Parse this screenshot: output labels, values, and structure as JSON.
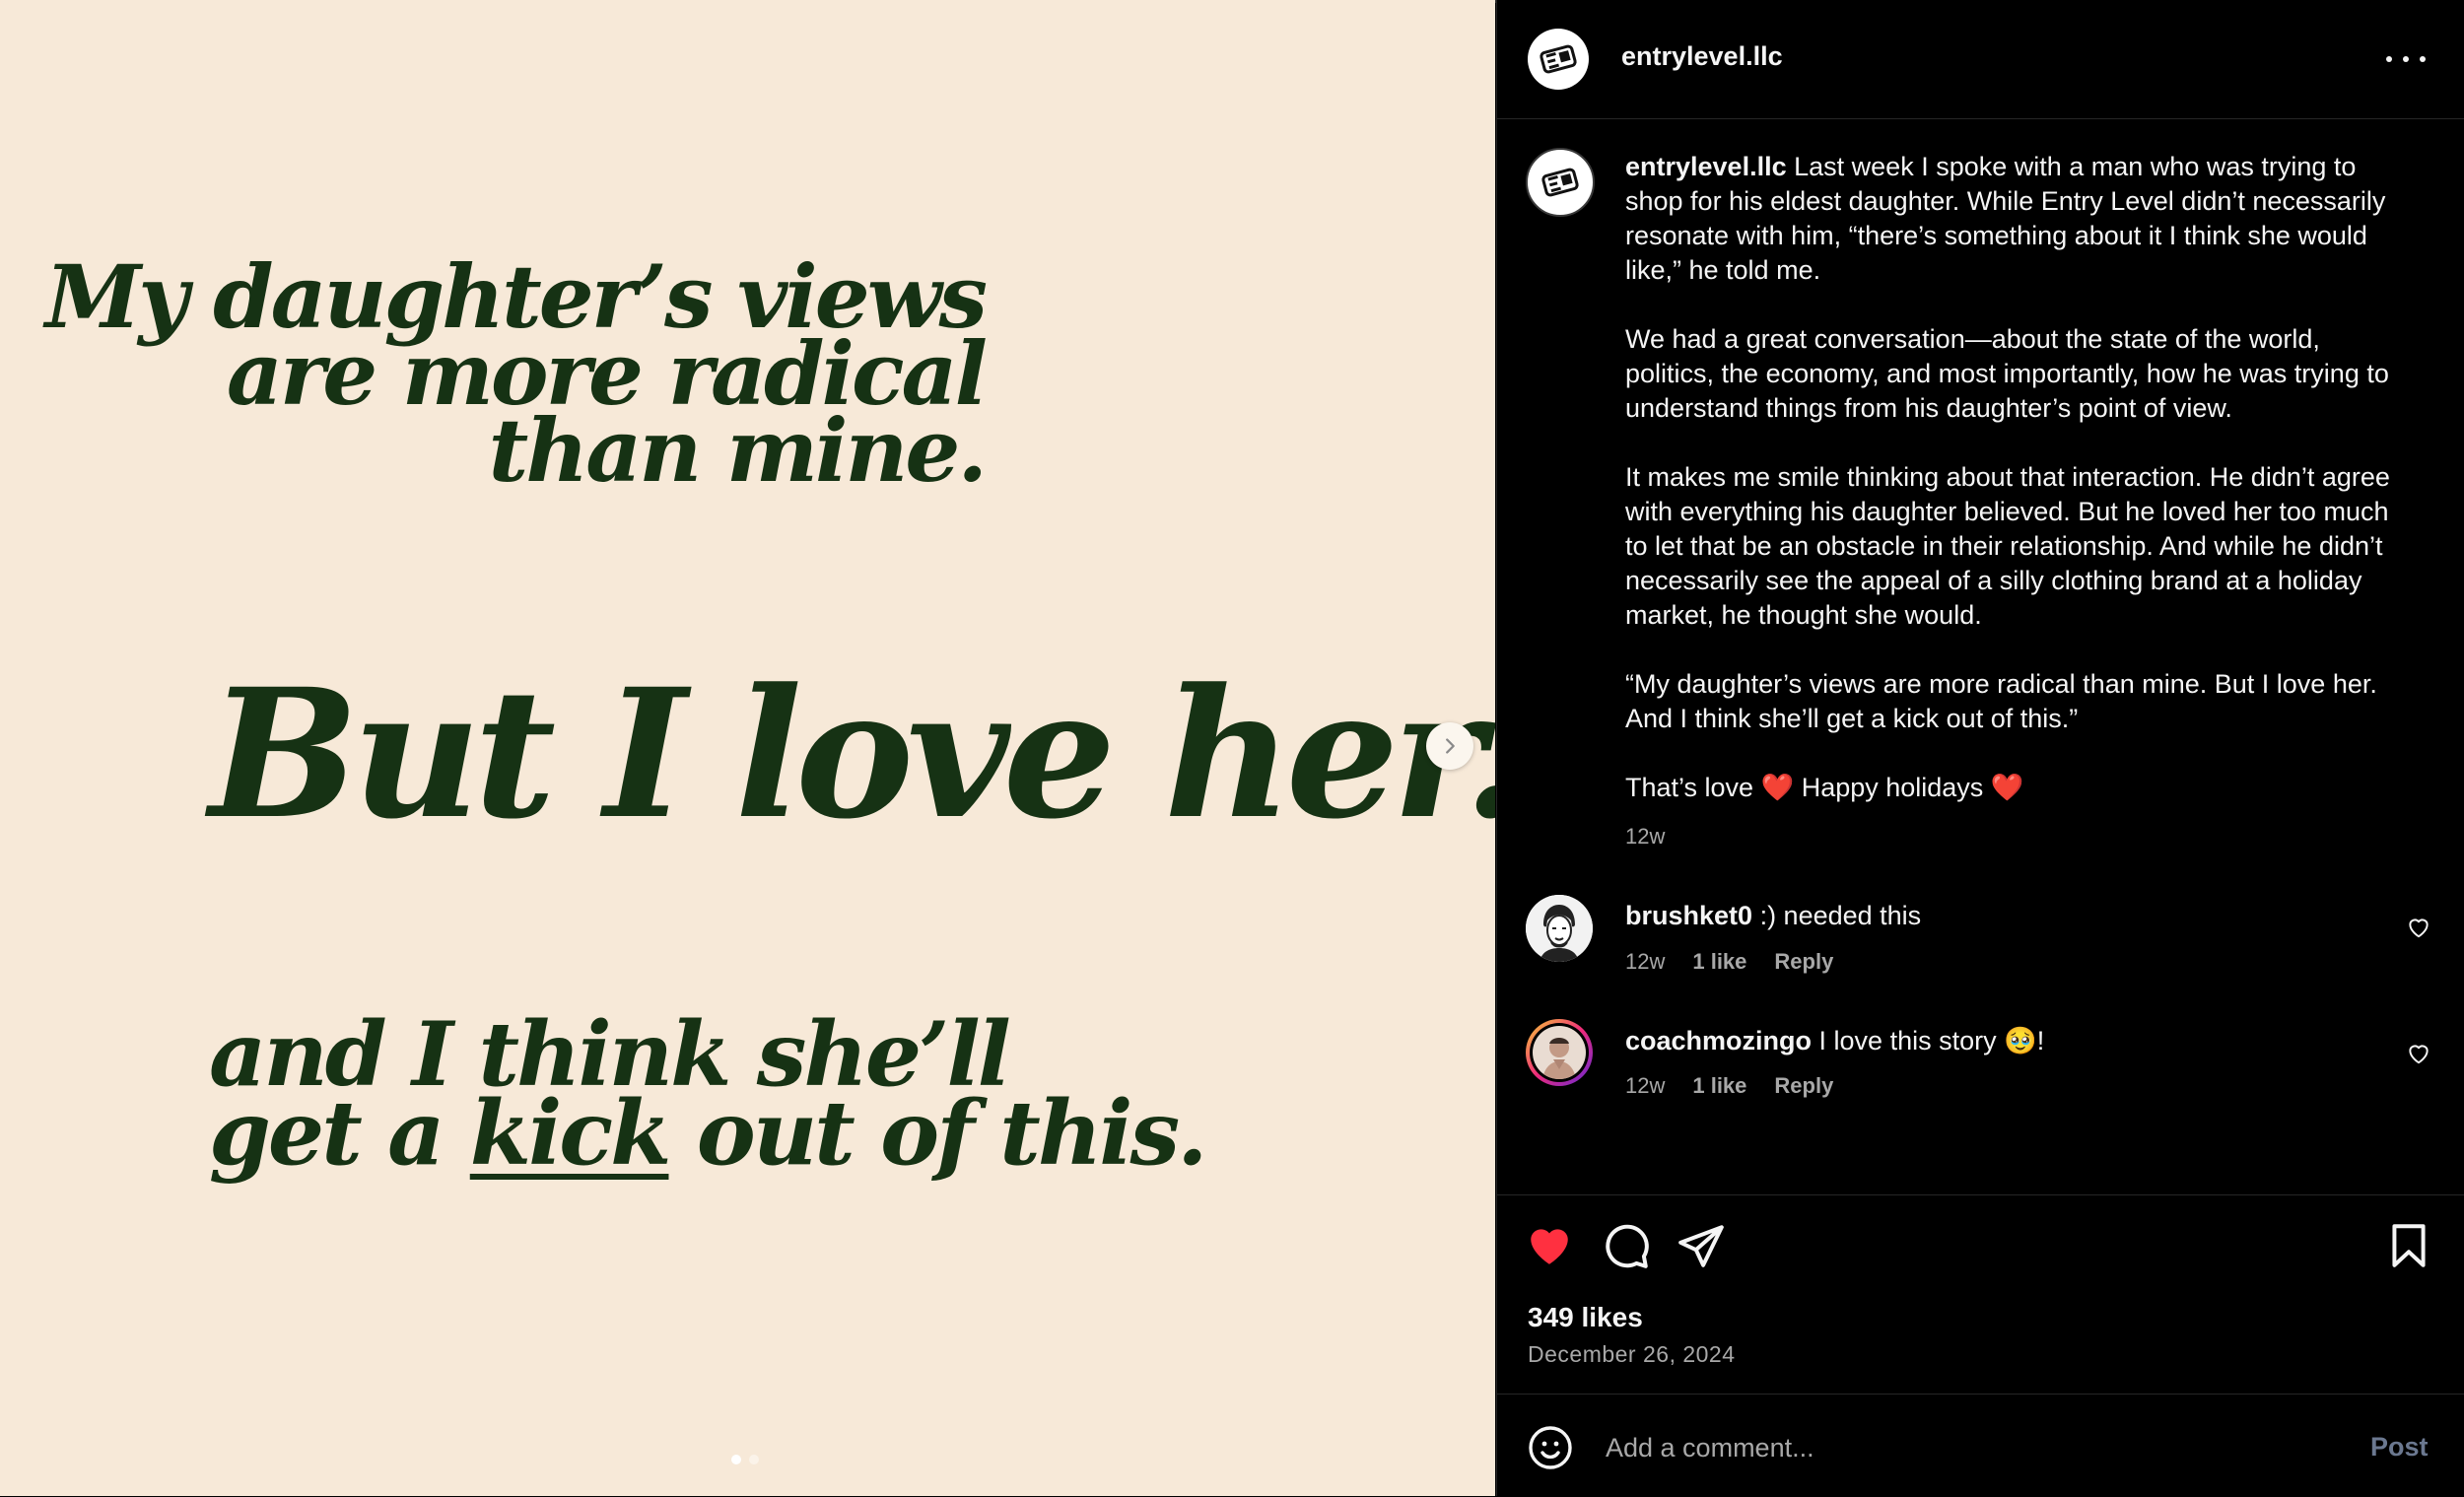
{
  "post": {
    "slide": {
      "line1": [
        "My daughter’s views",
        "are more radical",
        "than mine."
      ],
      "line2": "But I love her...",
      "line3_a": "and I think she’ll",
      "line3_b_pre": "get a ",
      "line3_b_kick": "kick",
      "line3_b_post": " out of this.",
      "current_slide": 1,
      "total_slides": 2
    }
  },
  "header": {
    "username": "entrylevel.llc",
    "more_icon": "more-horizontal-icon"
  },
  "caption": {
    "username": "entrylevel.llc",
    "paragraphs": [
      "Last week I spoke with a man who was trying to shop for his eldest daughter. While Entry Level didn’t necessarily resonate with him, “there’s something about it I think she would like,” he told me.",
      "We had a great conversation—about the state of the world, politics, the economy, and most importantly, how he was trying to understand things from his daughter’s point of view.",
      "It makes me smile thinking about that interaction. He didn’t agree with everything his daughter believed. But he loved her too much to let that be an obstacle in their relationship. And while he didn’t necessarily see the appeal of a silly clothing brand at a holiday market, he thought she would.",
      "“My daughter’s views are more radical than mine. But I love her. And I think she’ll get a kick out of this.”",
      "That’s love ❤️ Happy holidays ❤️"
    ],
    "time": "12w"
  },
  "comments": [
    {
      "username": "brushket0",
      "text": ":) needed this",
      "time": "12w",
      "likes": "1 like",
      "reply": "Reply"
    },
    {
      "username": "coachmozingo",
      "text": "I love this story 🥹!",
      "time": "12w",
      "likes": "1 like",
      "reply": "Reply"
    }
  ],
  "actions": {
    "likes": "349 likes",
    "date": "December 26, 2024",
    "liked": true,
    "like_color": "#ff3040"
  },
  "add_comment": {
    "placeholder": "Add a comment...",
    "post_label": "Post"
  },
  "colors": {
    "slide_bg": "#f7e9d8",
    "slide_text": "#163214",
    "panel_bg": "#000000"
  }
}
